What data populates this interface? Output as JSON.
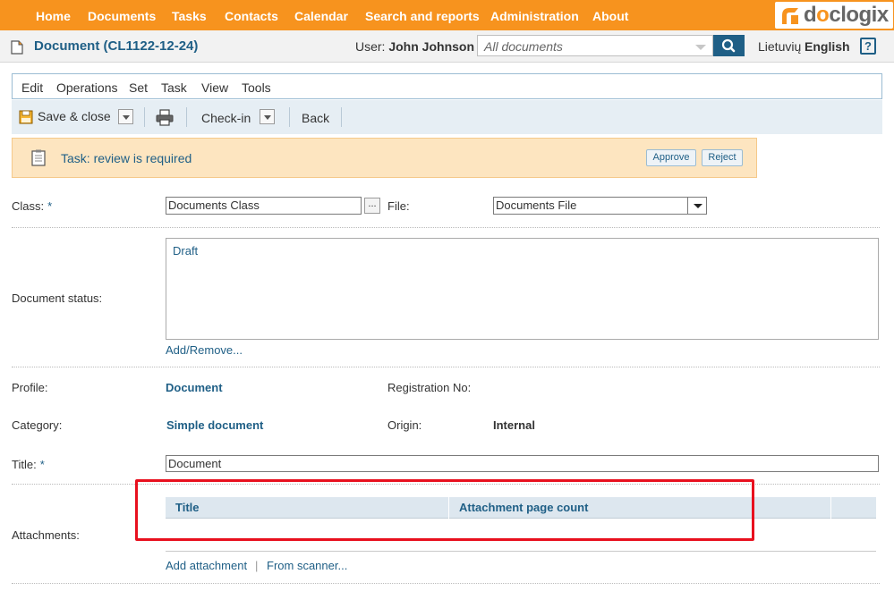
{
  "nav": {
    "items": [
      "Home",
      "Documents",
      "Tasks",
      "Contacts",
      "Calendar",
      "Search and reports",
      "Administration",
      "About"
    ],
    "logo_text": "doclogix"
  },
  "header": {
    "title": "Document (CL1122-12-24)",
    "user_label": "User:",
    "user_name": "John Johnson",
    "search_placeholder": "All documents",
    "lang_1": "Lietuvių",
    "lang_2": "English",
    "help_glyph": "?"
  },
  "menu": [
    "Edit",
    "Operations",
    "Set",
    "Task",
    "View",
    "Tools"
  ],
  "toolbar": {
    "save_close": "Save & close",
    "checkin": "Check-in",
    "back": "Back"
  },
  "task": {
    "text": "Task: review is required",
    "approve": "Approve",
    "reject": "Reject"
  },
  "form": {
    "class_label": "Class:",
    "required_mark": "*",
    "class_value": "Documents Class",
    "ellipsis": "...",
    "file_label": "File:",
    "file_value": "Documents File",
    "status_label": "Document status:",
    "status_value": "Draft",
    "add_remove": "Add/Remove...",
    "profile_label": "Profile:",
    "profile_value": "Document",
    "regno_label": "Registration No:",
    "category_label": "Category:",
    "category_value": "Simple document",
    "origin_label": "Origin:",
    "origin_value": "Internal",
    "title_label": "Title:",
    "title_value": "Document",
    "attachments_label": "Attachments:"
  },
  "attachments": {
    "columns": [
      "Title",
      "Attachment page count"
    ],
    "add_attachment": "Add attachment",
    "divider": "|",
    "from_scanner": "From scanner..."
  },
  "colors": {
    "nav_bg": "#f7931e",
    "brand_blue": "#1f5f86",
    "task_bg": "#fde5c0",
    "highlight": "#e8101e"
  }
}
